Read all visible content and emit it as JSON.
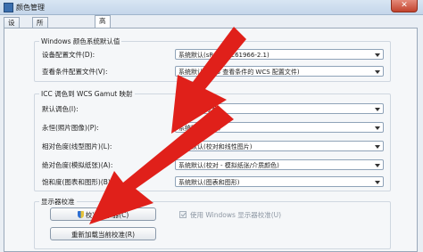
{
  "window": {
    "title": "颜色管理",
    "close_glyph": "✕"
  },
  "tabs": [
    "设备",
    "所有配置文件",
    "高级"
  ],
  "windows_defaults": {
    "group_title": "Windows 颜色系统默认值",
    "rows": [
      {
        "label": "设备配置文件(D):",
        "value": "系统默认(sRGB IEC61966-2.1)"
      },
      {
        "label": "查看条件配置文件(V):",
        "value": "系统默认(WCS 查看条件的 WCS 配置文件)"
      }
    ]
  },
  "icc_mapping": {
    "group_title": "ICC 调色到 WCS Gamut 映射",
    "rows": [
      {
        "label": "默认调色(I):",
        "value": "系统默认(永恒)"
      },
      {
        "label": "永恒(照片图像)(P):",
        "value": "系统默认(摄影)"
      },
      {
        "label": "相对色度(线型图片)(L):",
        "value": "系统默认(校对和线性图片)"
      },
      {
        "label": "绝对色度(模拟纸张)(A):",
        "value": "系统默认(校对 - 模拟纸张/介质颜色)"
      },
      {
        "label": "饱和度(图表和图形)(B):",
        "value": "系统默认(图表和图形)"
      }
    ]
  },
  "calibration": {
    "group_title": "显示器校准",
    "calibrate_button": "校准显示器(C)",
    "reload_button": "重新加载当前校准(R)",
    "use_windows_calibration_label": "使用 Windows 显示器校准(U)",
    "use_windows_calibration_checked": true
  },
  "colors": {
    "arrow": "#e0201a",
    "window_bg": "#e9eef4"
  }
}
